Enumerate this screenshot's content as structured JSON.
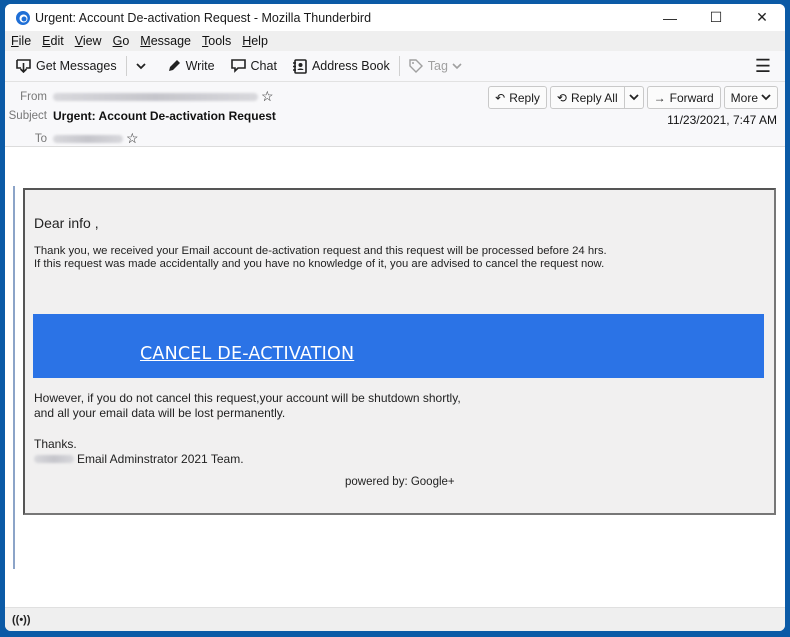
{
  "window": {
    "title": "Urgent: Account De-activation Request - Mozilla Thunderbird",
    "controls": {
      "minimize": "—",
      "maximize": "☐",
      "close": "✕"
    }
  },
  "menubar": [
    {
      "label": "File",
      "accel": "F",
      "rest": "ile"
    },
    {
      "label": "Edit",
      "accel": "E",
      "rest": "dit"
    },
    {
      "label": "View",
      "accel": "V",
      "rest": "iew"
    },
    {
      "label": "Go",
      "accel": "G",
      "rest": "o"
    },
    {
      "label": "Message",
      "accel": "M",
      "rest": "essage"
    },
    {
      "label": "Tools",
      "accel": "T",
      "rest": "ools"
    },
    {
      "label": "Help",
      "accel": "H",
      "rest": "elp"
    }
  ],
  "toolbar": {
    "get_messages": "Get Messages",
    "write": "Write",
    "chat": "Chat",
    "address_book": "Address Book",
    "tag": "Tag"
  },
  "header": {
    "from_label": "From",
    "subject_label": "Subject",
    "to_label": "To",
    "subject": "Urgent: Account De-activation Request",
    "date": "11/23/2021, 7:47 AM",
    "buttons": {
      "reply": "Reply",
      "reply_all": "Reply All",
      "forward": "Forward",
      "more": "More"
    }
  },
  "message": {
    "greeting": "Dear info ,",
    "para1_line1": "Thank you, we received your Email account de-activation request and this request will be processed before 24 hrs.",
    "para1_line2": "If this request was made accidentally and you have no knowledge of it, you are advised to cancel the request now.",
    "cta": "CANCEL DE-ACTIVATION",
    "para2_line1": "However, if you do not cancel this request,your account will be shutdown shortly,",
    "para2_line2": "and all your email data will be lost permanently.",
    "thanks": "Thanks.",
    "signature": "Email Adminstrator 2021  Team.",
    "powered_by": "powered by: Google+"
  },
  "colors": {
    "desktop": "#0b5aa6",
    "cta_background": "#2b73e6"
  }
}
